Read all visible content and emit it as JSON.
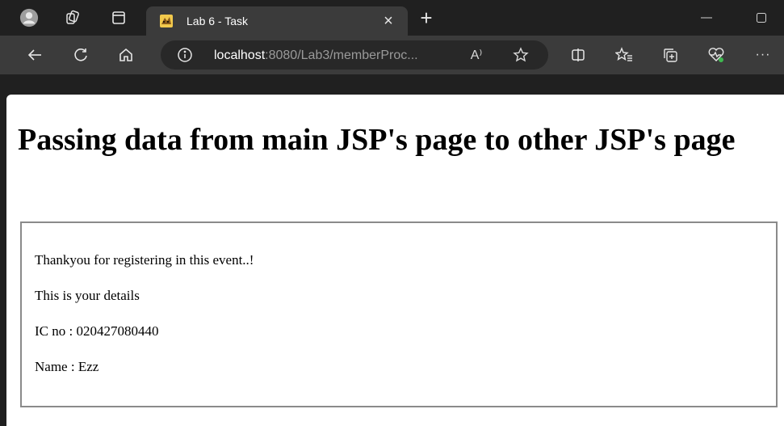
{
  "browser": {
    "tab": {
      "title": "Lab 6 - Task",
      "close_glyph": "×"
    },
    "new_tab_glyph": "+",
    "address": {
      "host": "localhost",
      "rest": ":8080/Lab3/memberProc..."
    },
    "read_aloud_glyph": "A⁾",
    "more_glyph": "···",
    "icons": [
      "profile-avatar-icon",
      "workspaces-icon",
      "tab-actions-icon",
      "minimize-icon",
      "maximize-icon",
      "back-arrow-icon",
      "refresh-icon",
      "home-icon",
      "info-icon",
      "read-aloud-icon",
      "star-icon",
      "split-screen-icon",
      "favorites-icon",
      "collections-icon",
      "browser-essentials-icon",
      "more-icon"
    ],
    "colors": {
      "tabstrip_bg": "#202020",
      "toolbar_bg": "#3b3b3b",
      "address_bg": "#282828",
      "page_bg": "#ffffff"
    }
  },
  "page": {
    "heading": "Passing data from main JSP's page to other JSP's page",
    "lines": [
      "Thankyou for registering in this event..!",
      "This is your details",
      "IC no : 020427080440",
      "Name : Ezz"
    ]
  }
}
